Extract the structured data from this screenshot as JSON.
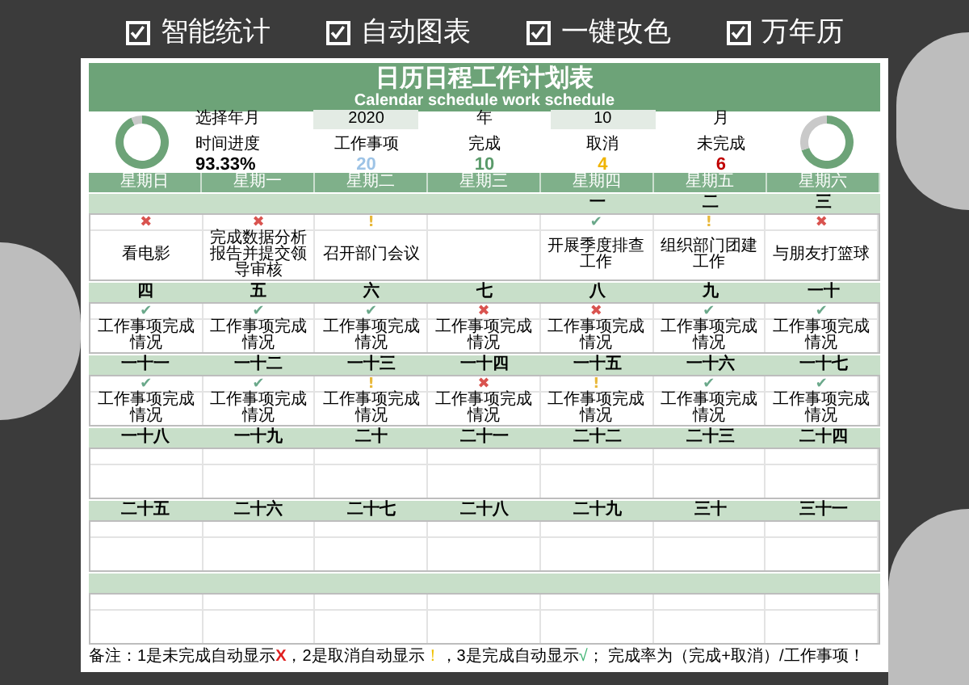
{
  "features": [
    {
      "label": "智能统计",
      "checked": true
    },
    {
      "label": "自动图表",
      "checked": true
    },
    {
      "label": "一键改色",
      "checked": true
    },
    {
      "label": "万年历",
      "checked": true
    }
  ],
  "title": "日历日程工作计划表",
  "subtitle": "Calendar schedule work schedule",
  "progress_ring": {
    "chart_data": {
      "type": "donut",
      "values": [
        93.33,
        6.67
      ]
    }
  },
  "year_month": {
    "label": "选择年月",
    "year": "2020",
    "year_unit": "年",
    "month": "10",
    "month_unit": "月"
  },
  "stats": [
    {
      "label": "时间进度",
      "value": "93.33%",
      "color": "#000000"
    },
    {
      "label": "工作事项",
      "value": "20",
      "color": "#9dc3e6"
    },
    {
      "label": "完成",
      "value": "10",
      "color": "#5a9a6a"
    },
    {
      "label": "取消",
      "value": "4",
      "color": "#f0b400"
    },
    {
      "label": "未完成",
      "value": "6",
      "color": "#c00000"
    }
  ],
  "completion_ring": {
    "chart_data": {
      "type": "donut",
      "values": [
        70,
        30
      ]
    }
  },
  "weekdays": [
    "星期日",
    "星期一",
    "星期二",
    "星期三",
    "星期四",
    "星期五",
    "星期六"
  ],
  "weeks": [
    {
      "days": {
        "sun": {
          "mark": "✖",
          "color": "#d9534f",
          "task": "看电影"
        },
        "mon": {
          "mark": "✖",
          "color": "#d9534f",
          "task": "完成数据分析报告并提交领导审核"
        },
        "tue": {
          "mark": "!",
          "color": "#e8b83a",
          "task": "召开部门会议"
        },
        "thu": {
          "date": "一",
          "mark": "✔",
          "color": "#6aa88a",
          "task": "开展季度排查工作"
        },
        "fri": {
          "date": "二",
          "mark": "!",
          "color": "#e8b83a",
          "task": "组织部门团建工作"
        },
        "sat": {
          "date": "三",
          "mark": "✖",
          "color": "#d9534f",
          "task": "与朋友打篮球"
        }
      }
    },
    {
      "days": [
        {
          "date": "四",
          "mark": "✔",
          "color": "#6aa88a",
          "task": "工作事项完成情况"
        },
        {
          "date": "五",
          "mark": "✔",
          "color": "#6aa88a",
          "task": "工作事项完成情况"
        },
        {
          "date": "六",
          "mark": "✔",
          "color": "#6aa88a",
          "task": "工作事项完成情况"
        },
        {
          "date": "七",
          "mark": "✖",
          "color": "#d9534f",
          "task": "工作事项完成情况"
        },
        {
          "date": "八",
          "mark": "✖",
          "color": "#d9534f",
          "task": "工作事项完成情况"
        },
        {
          "date": "九",
          "mark": "✔",
          "color": "#6aa88a",
          "task": "工作事项完成情况"
        },
        {
          "date": "一十",
          "mark": "✔",
          "color": "#6aa88a",
          "task": "工作事项完成情况"
        }
      ]
    },
    {
      "days": [
        {
          "date": "一十一",
          "mark": "✔",
          "color": "#6aa88a",
          "task": "工作事项完成情况"
        },
        {
          "date": "一十二",
          "mark": "✔",
          "color": "#6aa88a",
          "task": "工作事项完成情况"
        },
        {
          "date": "一十三",
          "mark": "!",
          "color": "#e8b83a",
          "task": "工作事项完成情况"
        },
        {
          "date": "一十四",
          "mark": "✖",
          "color": "#d9534f",
          "task": "工作事项完成情况"
        },
        {
          "date": "一十五",
          "mark": "!",
          "color": "#e8b83a",
          "task": "工作事项完成情况"
        },
        {
          "date": "一十六",
          "mark": "✔",
          "color": "#6aa88a",
          "task": "工作事项完成情况"
        },
        {
          "date": "一十七",
          "mark": "✔",
          "color": "#6aa88a",
          "task": "工作事项完成情况"
        }
      ]
    },
    {
      "days": [
        {
          "date": "一十八"
        },
        {
          "date": "一十九"
        },
        {
          "date": "二十"
        },
        {
          "date": "二十一"
        },
        {
          "date": "二十二"
        },
        {
          "date": "二十三"
        },
        {
          "date": "二十四"
        }
      ]
    },
    {
      "days": [
        {
          "date": "二十五"
        },
        {
          "date": "二十六"
        },
        {
          "date": "二十七"
        },
        {
          "date": "二十八"
        },
        {
          "date": "二十九"
        },
        {
          "date": "三十"
        },
        {
          "date": "三十一"
        }
      ]
    }
  ],
  "note": [
    {
      "kind": "plain",
      "text": "备注：1是未完成自动显示"
    },
    {
      "kind": "cross",
      "text": "X"
    },
    {
      "kind": "plain",
      "text": "，2是取消自动显示"
    },
    {
      "kind": "exclaim",
      "text": "！"
    },
    {
      "kind": "plain",
      "text": "，3是完成自动显示"
    },
    {
      "kind": "check",
      "text": "√"
    },
    {
      "kind": "plain",
      "text": "；  完成率为（完成+取消）/工作事项！"
    }
  ]
}
